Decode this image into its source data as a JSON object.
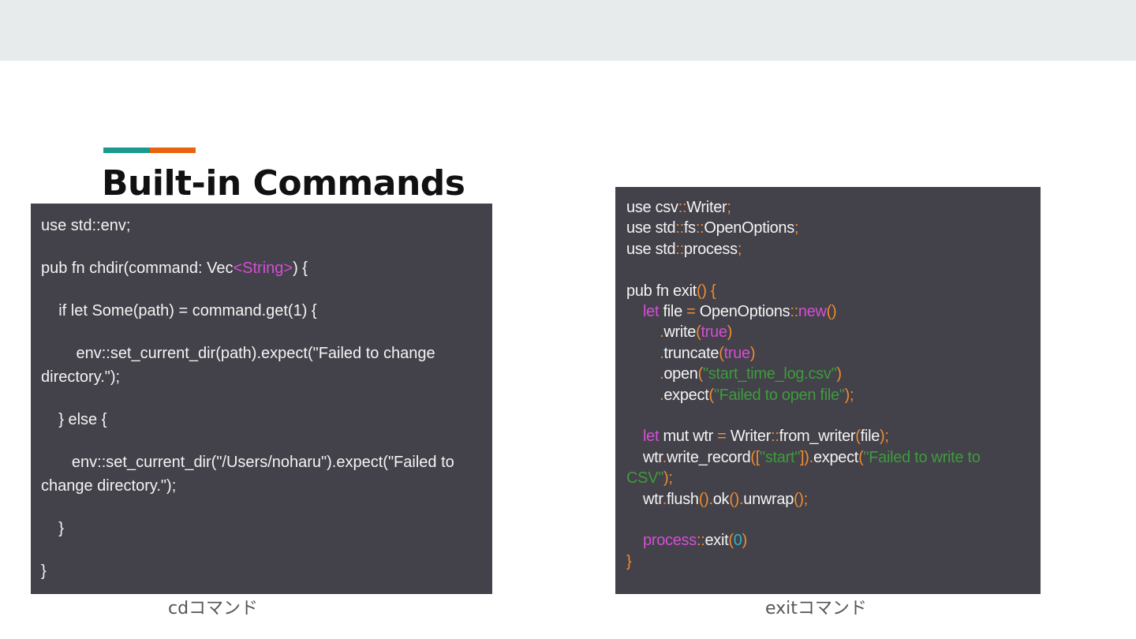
{
  "colors": {
    "top_band": "#e7ebec",
    "accent_teal": "#1a9a8c",
    "accent_orange": "#e8620f",
    "code_background": "#434149",
    "code_text": "#f4f4f4",
    "keyword": "#d44fd4",
    "punctuation": "#f08c30",
    "string": "#3e9b3e",
    "number": "#2fb3c7"
  },
  "slide": {
    "title": "Built-in Commands"
  },
  "left_code": {
    "line1": "use std::env;",
    "line2a": "pub fn chdir(command: Vec",
    "line2b": "<String>",
    "line2c": ") {",
    "line3": "    if let Some(path) = command.get(1) {",
    "line4": "        env::set_current_dir(path).expect(\"Failed to change directory.\");",
    "line5": "    } else {",
    "line6": "       env::set_current_dir(\"/Users/noharu\").expect(\"Failed to change directory.\");",
    "line7": "    }",
    "line8": "}"
  },
  "right_code": {
    "l1": [
      "use csv",
      "::",
      "Writer",
      ";"
    ],
    "l2": [
      "use std",
      "::",
      "fs",
      "::",
      "OpenOptions",
      ";"
    ],
    "l3": [
      "use std",
      "::",
      "process",
      ";"
    ],
    "l5": [
      "pub fn exit",
      "()",
      " ",
      "{"
    ],
    "l6": [
      "    ",
      "let",
      " file ",
      "=",
      " OpenOptions",
      "::",
      "new",
      "()"
    ],
    "l7": [
      "        ",
      ".",
      "write",
      "(",
      "true",
      ")"
    ],
    "l8": [
      "        ",
      ".",
      "truncate",
      "(",
      "true",
      ")"
    ],
    "l9": [
      "        ",
      ".",
      "open",
      "(",
      "\"start_time_log.csv\"",
      ")"
    ],
    "l10": [
      "        ",
      ".",
      "expect",
      "(",
      "\"Failed to open file\"",
      ")",
      ";"
    ],
    "l12": [
      "    ",
      "let",
      " mut wtr ",
      "=",
      " Writer",
      "::",
      "from_writer",
      "(",
      "file",
      ")",
      ";"
    ],
    "l13": [
      "    wtr",
      ".",
      "write_record",
      "([",
      "\"start\"",
      "])",
      ".",
      "expect",
      "(",
      "\"Failed to write to CSV\"",
      ")",
      ";"
    ],
    "l14": [
      "    wtr",
      ".",
      "flush",
      "()",
      ".",
      "ok",
      "()",
      ".",
      "unwrap",
      "()",
      ";"
    ],
    "l16": [
      "    ",
      "process",
      "::",
      "exit",
      "(",
      "0",
      ")"
    ],
    "l17": [
      "}"
    ]
  },
  "captions": {
    "left": "cdコマンド",
    "right": "exitコマンド"
  }
}
